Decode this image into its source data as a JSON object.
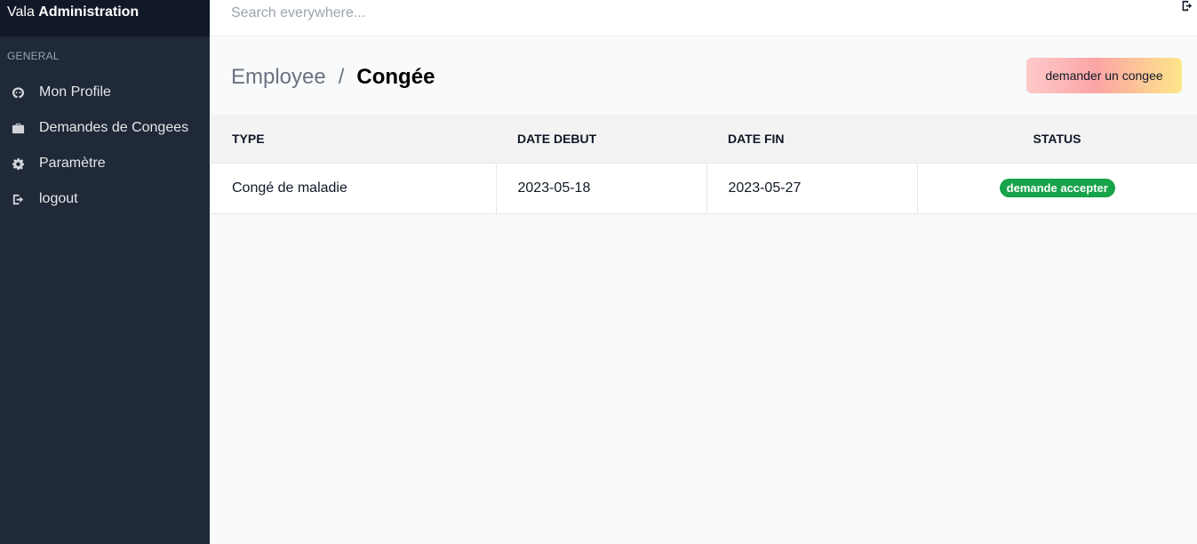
{
  "brand": {
    "prefix": "Vala",
    "name": "Administration"
  },
  "sidebar": {
    "section_label": "GENERAL",
    "items": [
      {
        "label": "Mon Profile",
        "icon": "profile-icon"
      },
      {
        "label": "Demandes de Congees",
        "icon": "briefcase-icon"
      },
      {
        "label": "Paramètre",
        "icon": "gear-icon"
      },
      {
        "label": "logout",
        "icon": "logout-icon"
      }
    ]
  },
  "search": {
    "placeholder": "Search everywhere..."
  },
  "header": {
    "breadcrumb_parent": "Employee",
    "breadcrumb_separator": "/",
    "breadcrumb_current": "Congée",
    "request_button_label": "demander un congee"
  },
  "table": {
    "columns": [
      "TYPE",
      "DATE DEBUT",
      "DATE FIN",
      "STATUS"
    ],
    "rows": [
      {
        "type": "Congé de maladie",
        "date_debut": "2023-05-18",
        "date_fin": "2023-05-27",
        "status": "demande accepter"
      }
    ]
  },
  "colors": {
    "sidebar_bg": "#1f2937",
    "brand_bg": "#111827",
    "status_accepted": "#16a34a"
  }
}
